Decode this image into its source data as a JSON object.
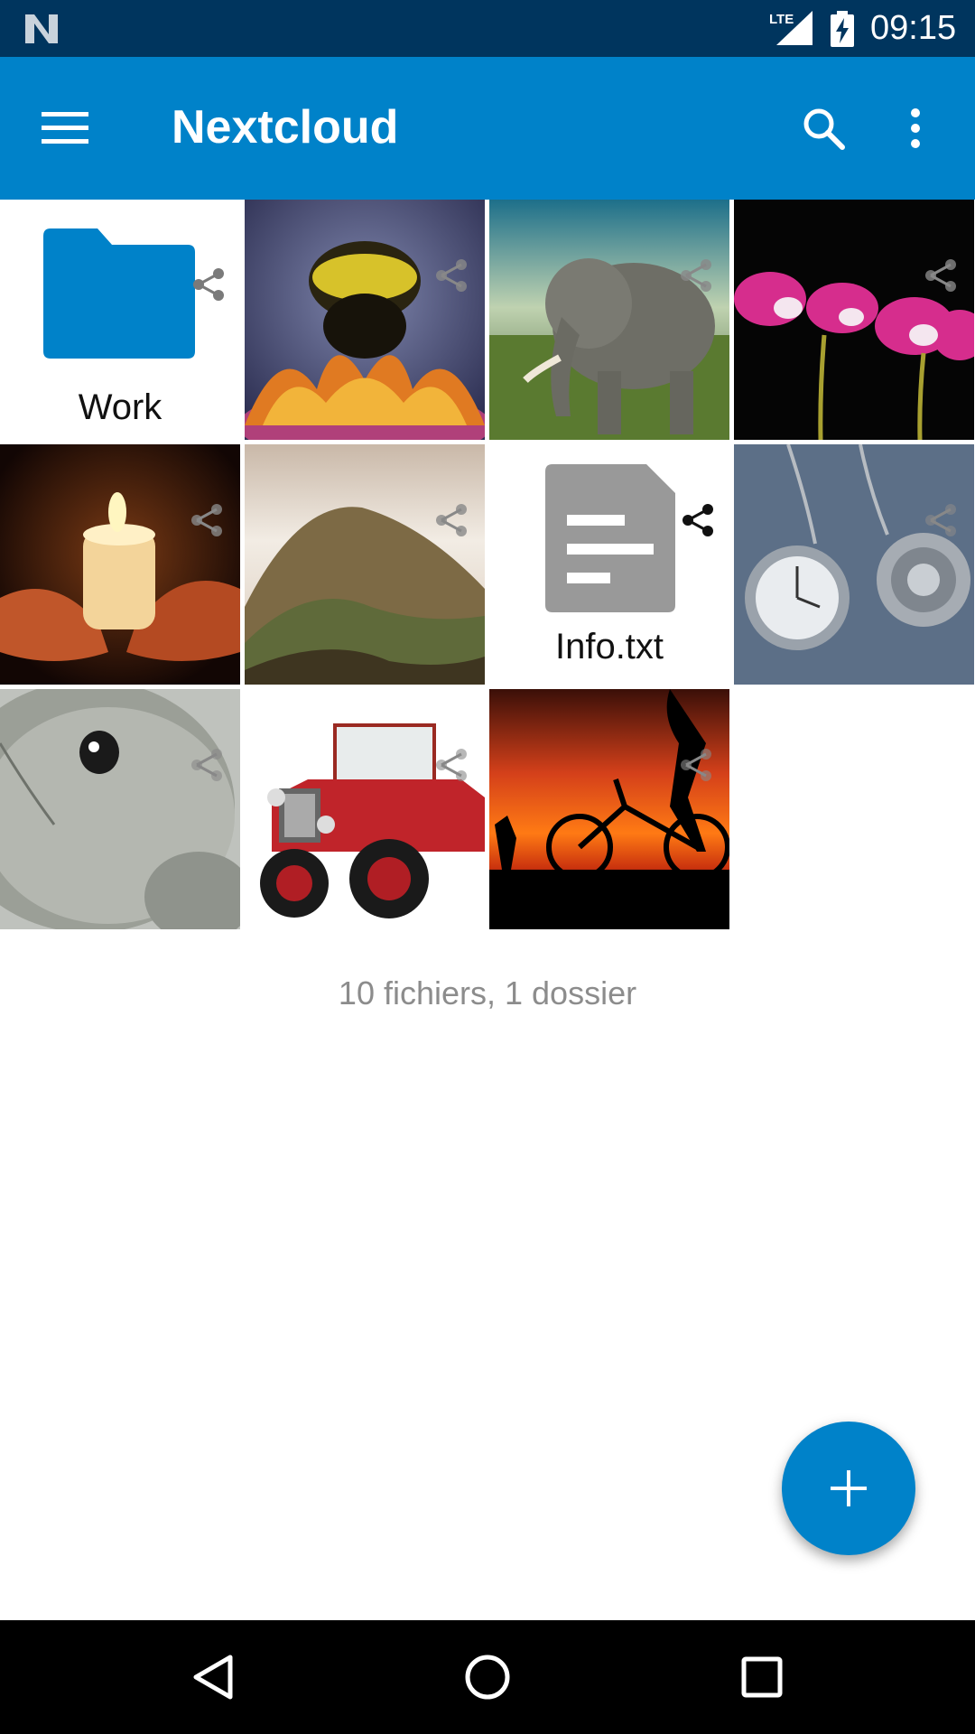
{
  "status_bar": {
    "time": "09:15",
    "network": "LTE",
    "icons": [
      "n-icon",
      "lte-signal-icon",
      "battery-charging-icon"
    ]
  },
  "toolbar": {
    "title": "Nextcloud",
    "icons": [
      "menu-icon",
      "search-icon",
      "more-vert-icon"
    ]
  },
  "files": [
    {
      "type": "folder",
      "name": "Work",
      "shared": true
    },
    {
      "type": "image",
      "subject": "bee"
    },
    {
      "type": "image",
      "subject": "elephant"
    },
    {
      "type": "image",
      "subject": "pink-flowers"
    },
    {
      "type": "image",
      "subject": "candle"
    },
    {
      "type": "image",
      "subject": "hills"
    },
    {
      "type": "text",
      "name": "Info.txt",
      "shared": true
    },
    {
      "type": "image",
      "subject": "pocket-watches"
    },
    {
      "type": "image",
      "subject": "seal"
    },
    {
      "type": "image",
      "subject": "fire-truck"
    },
    {
      "type": "image",
      "subject": "bicycle-sunset"
    }
  ],
  "summary": "10 fichiers, 1 dossier",
  "fab": {
    "icon": "plus-icon"
  },
  "nav": {
    "icons": [
      "back-icon",
      "home-icon",
      "recents-icon"
    ]
  },
  "colors": {
    "primary": "#0082c9",
    "status_bar": "#00355e",
    "folder": "#0082c9"
  }
}
